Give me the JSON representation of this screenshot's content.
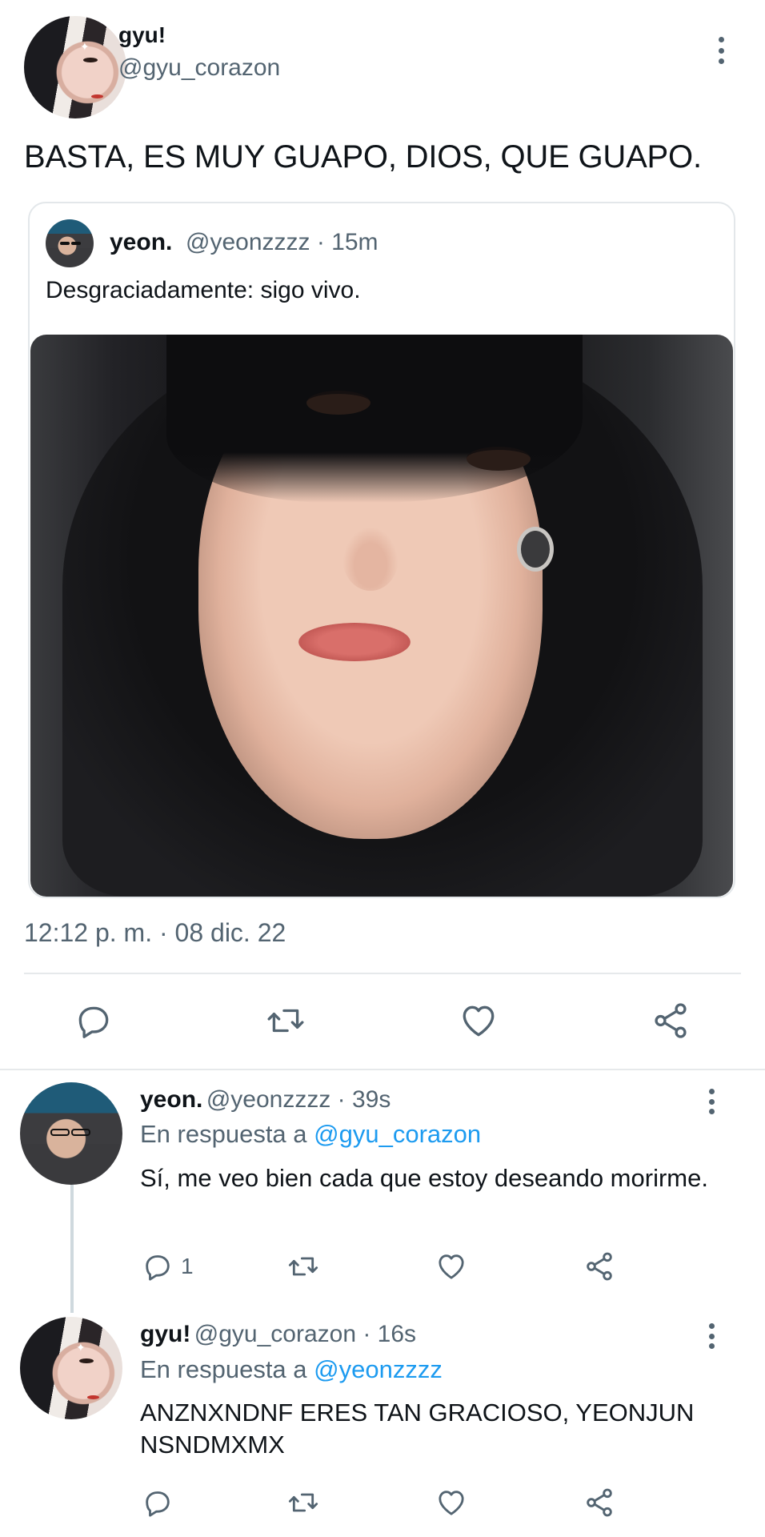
{
  "main_tweet": {
    "display_name": "gyu!",
    "handle": "@gyu_corazon",
    "text": "BASTA, ES MUY GUAPO, DIOS, QUE GUAPO.",
    "timestamp": "12:12 p. m. · 08 dic. 22",
    "quoted": {
      "display_name": "yeon.",
      "meta": "@yeonzzzz · 15m",
      "text": "Desgraciadamente: sigo vivo."
    }
  },
  "replies": [
    {
      "display_name": "yeon.",
      "meta": "@yeonzzzz · 39s",
      "reply_prefix": "En respuesta a",
      "reply_to": "@gyu_corazon",
      "text": "Sí, me veo bien cada que estoy deseando morirme.",
      "reply_count": "1"
    },
    {
      "display_name": "gyu!",
      "meta": "@gyu_corazon · 16s",
      "reply_prefix": "En respuesta a",
      "reply_to": "@yeonzzzz",
      "text": "ANZNXNDNF ERES TAN GRACIOSO, YEONJUN NSNDMXMX"
    }
  ],
  "icons": {
    "reply": "reply-icon",
    "retweet": "retweet-icon",
    "like": "heart-icon",
    "share": "share-icon",
    "more": "more-vertical-icon"
  },
  "colors": {
    "text_primary": "#0f1419",
    "text_secondary": "#536471",
    "mention": "#1d9bf0",
    "divider": "#e6e9eb"
  }
}
